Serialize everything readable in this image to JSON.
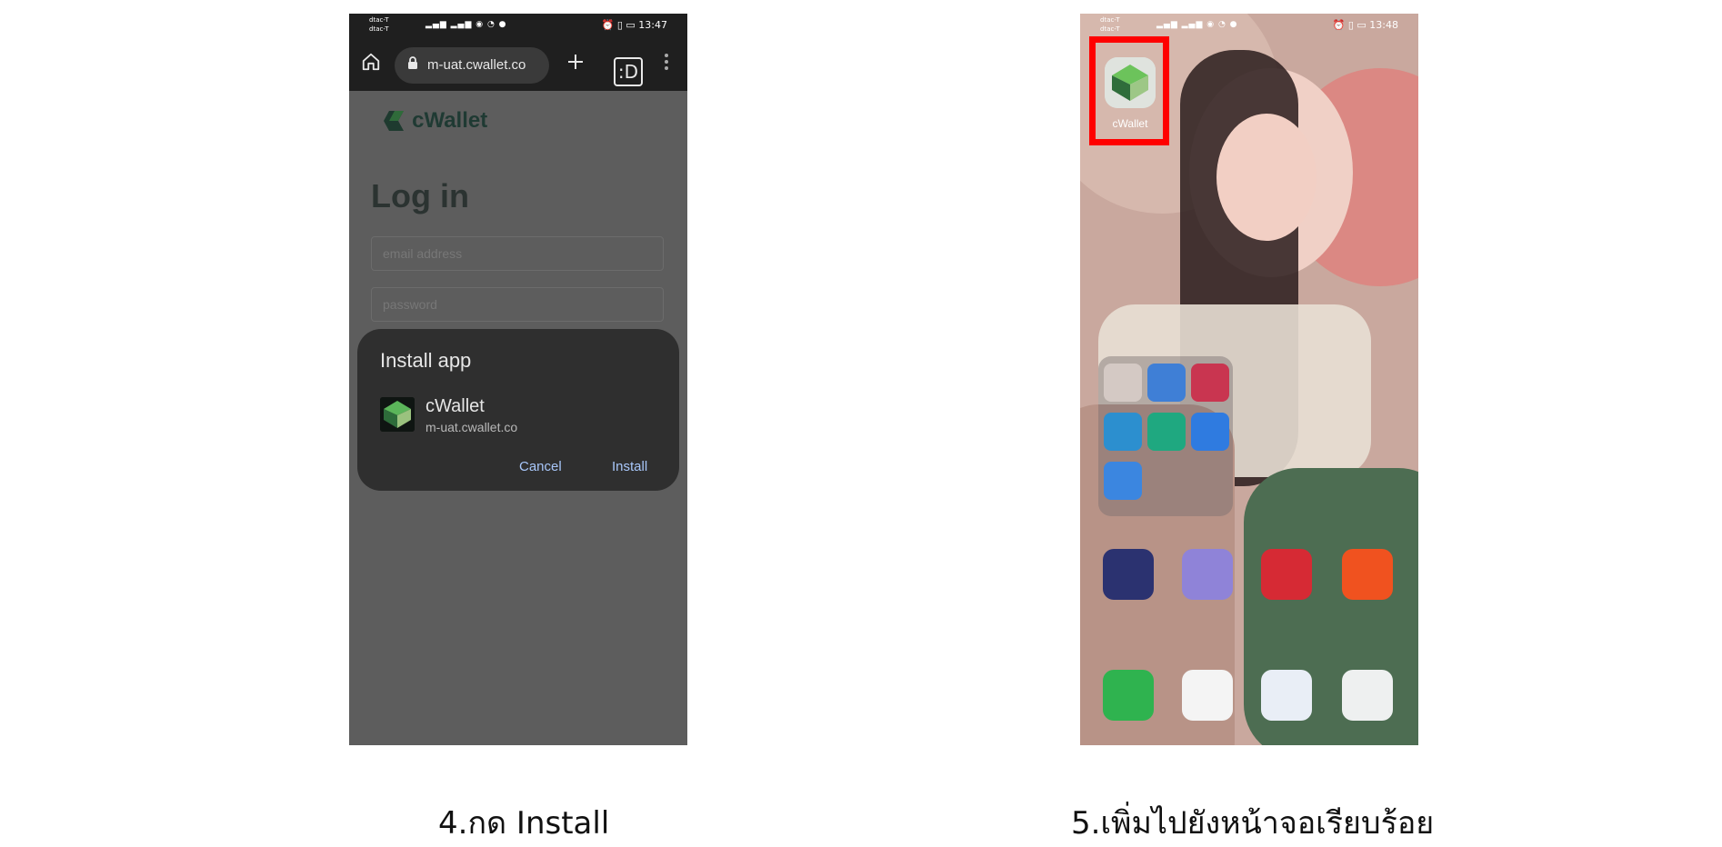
{
  "left_phone": {
    "status": {
      "carrier1": "dtac-T",
      "carrier2": "dtac-T",
      "time": "13:47"
    },
    "browser": {
      "url": "m-uat.cwallet.co"
    },
    "page": {
      "logo_text": "cWallet",
      "title": "Log in",
      "email_placeholder": "email address",
      "password_placeholder": "password"
    },
    "install_dialog": {
      "title": "Install app",
      "app_name": "cWallet",
      "app_url": "m-uat.cwallet.co",
      "cancel_label": "Cancel",
      "install_label": "Install"
    }
  },
  "right_phone": {
    "status": {
      "carrier1": "dtac-T",
      "carrier2": "dtac-T",
      "time": "13:48"
    },
    "home_app_label": "cWallet",
    "highlight_color": "#ff0000"
  },
  "captions": {
    "step4": "4.กด Install",
    "step5": "5.เพิ่มไปยังหน้าจอเรียบร้อย"
  },
  "icons": [
    "home-icon",
    "lock-icon",
    "plus-icon",
    "tabs-icon",
    "more-icon",
    "cwallet-logo-icon"
  ],
  "colors": {
    "link_blue": "#a8c7fa",
    "dialog_bg": "#2f2f2f",
    "overlay_bg": "#5d5d5d"
  }
}
